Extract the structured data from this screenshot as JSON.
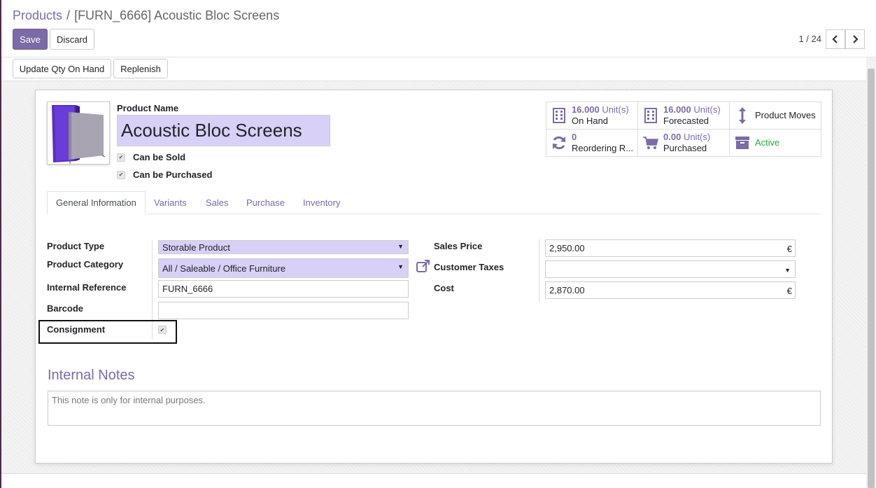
{
  "breadcrumb": {
    "parent": "Products",
    "separator": "/",
    "current": "[FURN_6666] Acoustic Bloc Screens"
  },
  "actions": {
    "save": "Save",
    "discard": "Discard"
  },
  "pager": {
    "value": "1 / 24"
  },
  "statusbar": {
    "update_qty": "Update Qty On Hand",
    "replenish": "Replenish"
  },
  "product": {
    "name_label": "Product Name",
    "name": "Acoustic Bloc Screens",
    "can_be_sold_label": "Can be Sold",
    "can_be_purchased_label": "Can be Purchased"
  },
  "stats": {
    "on_hand_value": "16.000",
    "on_hand_unit": "Unit(s)",
    "on_hand_label": "On Hand",
    "forecasted_value": "16.000",
    "forecasted_unit": "Unit(s)",
    "forecasted_label": "Forecasted",
    "product_moves_label": "Product Moves",
    "reordering_value": "0",
    "reordering_label": "Reordering R...",
    "purchased_value": "0.00",
    "purchased_unit": "Unit(s)",
    "purchased_label": "Purchased",
    "active_label": "Active"
  },
  "tabs": [
    "General Information",
    "Variants",
    "Sales",
    "Purchase",
    "Inventory"
  ],
  "fields": {
    "product_type_label": "Product Type",
    "product_type_value": "Storable Product",
    "product_category_label": "Product Category",
    "product_category_value": "All / Saleable / Office Furniture",
    "internal_reference_label": "Internal Reference",
    "internal_reference_value": "FURN_6666",
    "barcode_label": "Barcode",
    "barcode_value": "",
    "consignment_label": "Consignment",
    "sales_price_label": "Sales Price",
    "sales_price_value": "2,950.00",
    "customer_taxes_label": "Customer Taxes",
    "customer_taxes_value": "",
    "cost_label": "Cost",
    "cost_value": "2,870.00",
    "currency": "€"
  },
  "notes": {
    "title": "Internal Notes",
    "placeholder": "This note is only for internal purposes."
  },
  "colors": {
    "accent": "#7c6ba6",
    "required_field": "#d9d0f7",
    "active_green": "#28a745"
  }
}
